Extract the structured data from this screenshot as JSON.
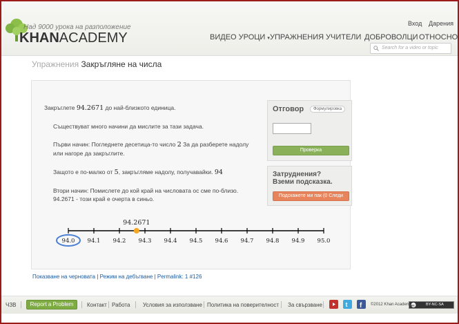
{
  "header": {
    "tagline": "Над 9000 урока на разположение",
    "logo_part1": "KHAN",
    "logo_part2": "ACADEMY",
    "login": "Вход",
    "donate": "Дарения",
    "nav": [
      "ВИДЕО УРОЦИ",
      "УПРАЖНЕНИЯ",
      "УЧИТЕЛИ",
      "ДОБРОВОЛЦИ",
      "ОТНОСНО"
    ],
    "search_placeholder": "Search for a video or topic"
  },
  "breadcrumb": {
    "parent": "Упражнения",
    "current": "Закръгляне на числа"
  },
  "problem": {
    "p1_pre": "Закръглете ",
    "p1_num": "94.2671",
    "p1_post": " до най-близкото единица.",
    "p2": "Съществуват много начини да мислите за тази задача.",
    "p3a": "Първи начин: Погледнете десетица-то число ",
    "p3_num": "2",
    "p3b": " За да разберете надолу",
    "p3c": "или нагоре да закръглите.",
    "p4_pre": "Защото е по-малко от ",
    "p4_num1": "5",
    "p4_mid": ", закръгляме надолу, получавайки. ",
    "p4_num2": "94",
    "p5a": "Втори начин: Помислете до кой край на числовата ос сме по-близо.",
    "p5b": "94.2671 - този край е очерта в синьо."
  },
  "chart_data": {
    "type": "number-line",
    "ticks": [
      "94.0",
      "94.1",
      "94.2",
      "94.3",
      "94.4",
      "94.5",
      "94.6",
      "94.7",
      "94.8",
      "94.9",
      "95.0"
    ],
    "range": [
      94.0,
      95.0
    ],
    "point_value": 94.2671,
    "point_label": "94.2671",
    "circled_tick": "94.0",
    "point_color": "#f5a623",
    "circle_color": "#4a7fd4"
  },
  "answer": {
    "title": "Отговор",
    "formula_label": "Формулировка",
    "input_value": "",
    "check_label": "Проверка"
  },
  "help": {
    "title_line1": "Затруднения?",
    "title_line2": "Вземи подсказка.",
    "hint_label": "Подскажете ми пак (0 Следи"
  },
  "links": {
    "show_scratchpad": "Показване на черновата",
    "debug_mode": "Режим на дебъгване",
    "permalink": "Permalink: 1 #126"
  },
  "footer": {
    "faq": "ЧЗВ",
    "report": "Report a Problem",
    "contact": "Контакт",
    "jobs": "Работа",
    "terms": "Условия за използване",
    "privacy": "Политика на поверителност",
    "connect": "За свързване",
    "copyright": "©2012 Khan Academy™",
    "license": "BY-NC-SA"
  },
  "colors": {
    "frame": "#9b1b1b",
    "check_button": "#8ab15a",
    "hint_button": "#e8845b",
    "report_button": "#7fab43",
    "link": "#1c5a9e"
  }
}
